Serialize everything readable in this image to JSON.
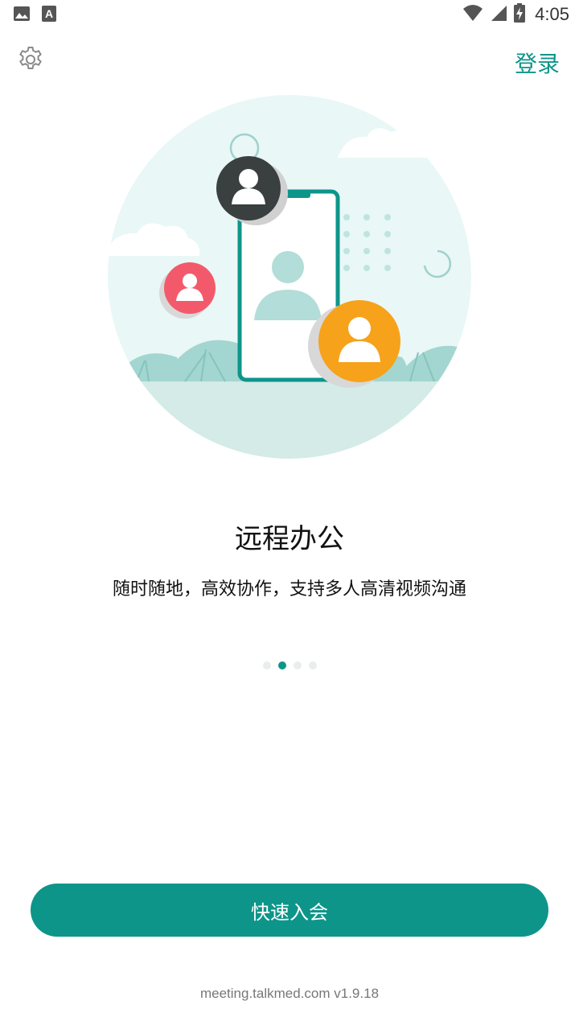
{
  "status_bar": {
    "time": "4:05",
    "icons": [
      "image-icon",
      "font-a-icon",
      "wifi-icon",
      "signal-icon",
      "battery-charging-icon"
    ]
  },
  "header": {
    "settings_icon": "gear-icon",
    "login_label": "登录"
  },
  "onboarding": {
    "title": "远程办公",
    "subtitle": "随时随地，高效协作，支持多人高清视频沟通",
    "page_index": 2,
    "page_count": 4
  },
  "actions": {
    "quick_join_label": "快速入会"
  },
  "footer": {
    "version_text": "meeting.talkmed.com v1.9.18"
  },
  "colors": {
    "accent": "#0e958a",
    "dot_inactive": "#e9eded",
    "avatar_dark": "#3a3f3f",
    "avatar_red": "#f25a6b",
    "avatar_orange": "#f7a21b",
    "circle_bg": "#e9f7f6",
    "ground": "#d4ebe8"
  }
}
